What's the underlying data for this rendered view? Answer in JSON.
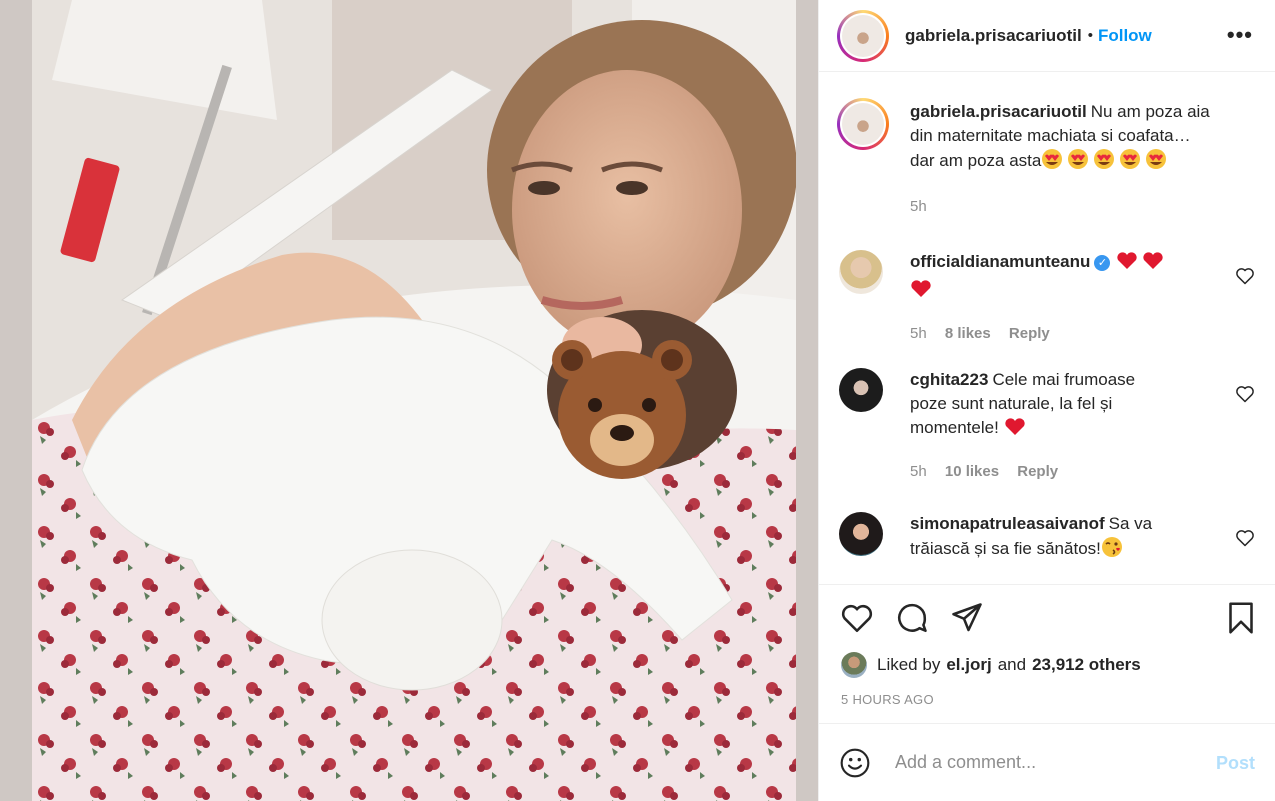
{
  "post": {
    "username": "gabriela.prisacariuotil",
    "separator": "•",
    "follow_label": "Follow",
    "more_label": "•••",
    "caption_lines": [
      "Nu am poza aia",
      "din maternitate machiata si coafata…",
      "dar am poza asta"
    ],
    "caption_time": "5h"
  },
  "comments": [
    {
      "username": "officialdianamunteanu",
      "verified": true,
      "text": "",
      "time": "5h",
      "likes": "8 likes",
      "reply": "Reply"
    },
    {
      "username": "cghita223",
      "text_parts": [
        "Cele mai frumoase",
        "poze sunt naturale, la fel și",
        "momentele!"
      ],
      "time": "5h",
      "likes": "10 likes",
      "reply": "Reply"
    },
    {
      "username": "simonapatruleasaivanof",
      "text_parts": [
        "Sa va",
        "trăiască și sa fie sănătos!"
      ]
    }
  ],
  "likes": {
    "prefix": "Liked by",
    "user": "el.jorj",
    "and": "and",
    "count": "23,912 others"
  },
  "timestamp": "5 HOURS AGO",
  "add_comment": {
    "placeholder": "Add a comment...",
    "post_label": "Post"
  },
  "icons": {
    "heart": "heart-icon",
    "comment": "comment-icon",
    "share": "share-icon",
    "save": "bookmark-icon",
    "emoji": "emoji-icon",
    "more": "more-icon"
  },
  "colors": {
    "link": "#0095f6",
    "muted": "#8e8e8e",
    "post_disabled": "#b2dffc",
    "heart_red": "#ed1c34"
  }
}
